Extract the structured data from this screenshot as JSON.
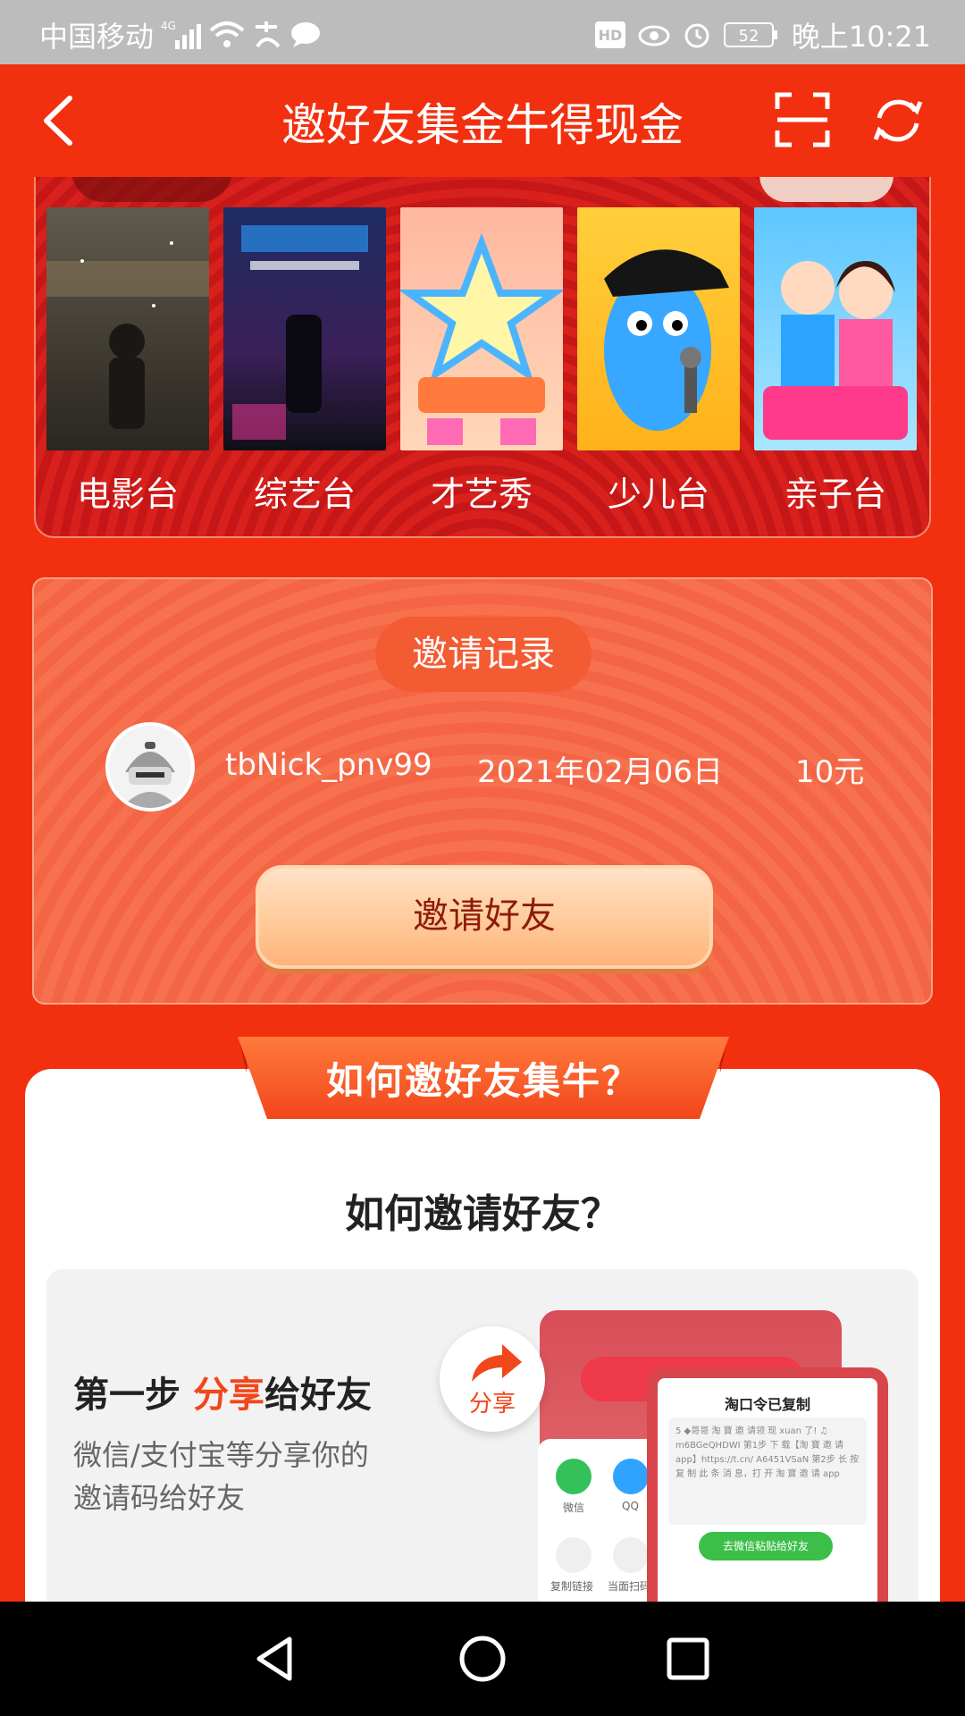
{
  "status_bar": {
    "carrier": "中国移动",
    "network": "4G",
    "hd": "HD",
    "battery": "52",
    "time": "晚上10:21"
  },
  "header": {
    "title": "邀好友集金牛得现金",
    "icons": [
      "back-icon",
      "scan-icon",
      "refresh-icon"
    ]
  },
  "channels": [
    {
      "label": "电影台"
    },
    {
      "label": "综艺台"
    },
    {
      "label": "才艺秀"
    },
    {
      "label": "少儿台"
    },
    {
      "label": "亲子台"
    }
  ],
  "invite_record": {
    "tag": "邀请记录",
    "rows": [
      {
        "name": "tbNick_pnv99",
        "date": "2021年02月06日",
        "amount": "10元"
      }
    ],
    "invite_button": "邀请好友"
  },
  "howto": {
    "ribbon": "如何邀好友集牛？",
    "subtitle": "如何邀请好友？",
    "step1": {
      "prefix": "第一步 ",
      "highlight": "分享",
      "suffix": "给好友",
      "desc": "微信/支付宝等分享你的邀请码给好友"
    },
    "mockup": {
      "share_label": "分享",
      "apps": [
        "微信",
        "QQ",
        "复制链接",
        "当面扫码"
      ],
      "popup_title": "淘口令已复制",
      "popup_text": "5 ◆哥哥 淘 寶 邀 请领 现 xuan 了! ♫ m6BGeQHDWI 第1步 下 载【淘 寶 邀 请 app】https://t.cn/ A6451VSaN 第2步 长 按 复 制 此 条 消 息，打 开 淘 寶 邀 请 app",
      "popup_button": "去微信粘贴给好友"
    }
  },
  "colors": {
    "brand_red": "#f2300f",
    "accent_orange": "#f2461b",
    "card_salmon": "#f46545"
  }
}
